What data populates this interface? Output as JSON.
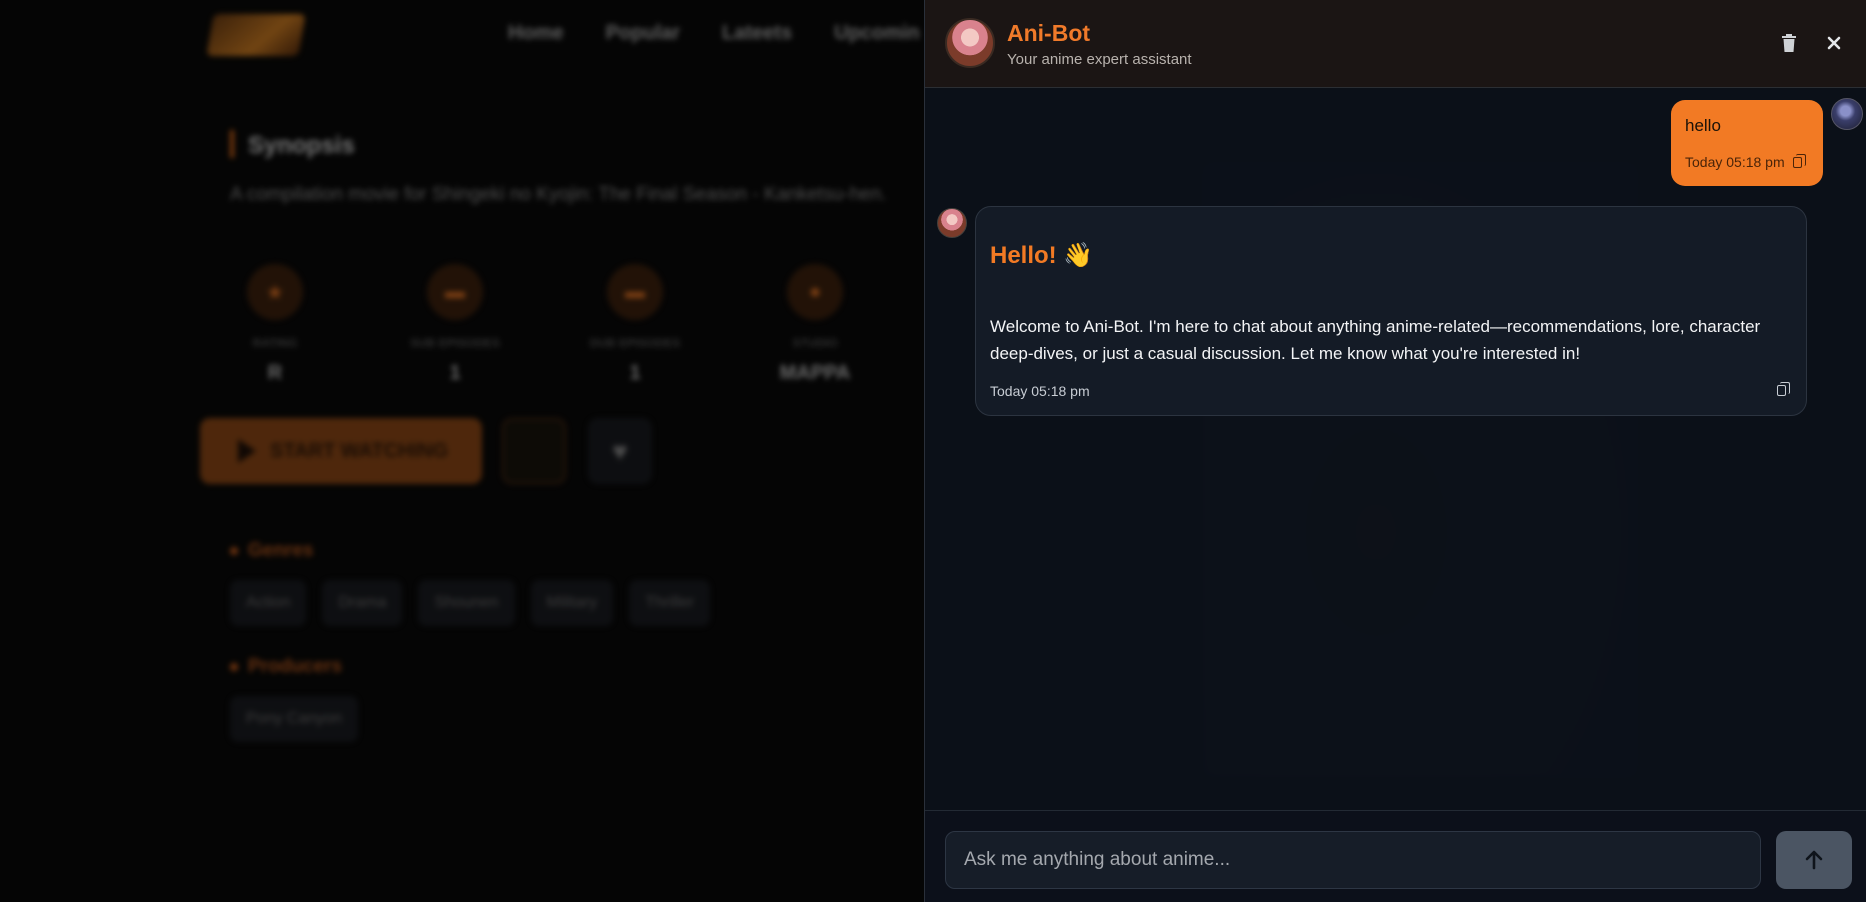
{
  "background": {
    "nav": [
      "Home",
      "Popular",
      "Lateets",
      "Upcomin"
    ],
    "synopsis_title": "Synopsis",
    "synopsis_text": "A compilation movie for Shingeki no Kyojin: The Final Season - Kanketsu-hen.",
    "stats": [
      {
        "label": "RATING",
        "value": "R",
        "icon": "star-icon"
      },
      {
        "label": "SUB EPISODES",
        "value": "1",
        "icon": "subtitle-icon"
      },
      {
        "label": "DUB EPISODES",
        "value": "1",
        "icon": "microphone-icon"
      },
      {
        "label": "STUDIO",
        "value": "MAPPA",
        "icon": "studio-icon"
      }
    ],
    "watch_label": "START WATCHING",
    "genres_title": "Genres",
    "genres": [
      "Action",
      "Drama",
      "Shounen",
      "Military",
      "Thriller"
    ],
    "producers_title": "Producers",
    "producers": [
      "Pony Canyon"
    ]
  },
  "chat": {
    "bot_name": "Ani-Bot",
    "bot_subtitle": "Your anime expert assistant",
    "user_message": "hello",
    "user_time": "Today 05:18 pm",
    "bot_hello": "Hello! 👋",
    "bot_message": "Welcome to Ani-Bot. I'm here to chat about anything anime-related—recommendations, lore, character deep-dives, or just a casual discussion. Let me know what you're interested in!",
    "bot_time": "Today 05:18 pm",
    "input_placeholder": "Ask me anything about anime...",
    "input_value": ""
  },
  "colors": {
    "accent": "#f27a24",
    "panel_bg": "#0c111a",
    "send_button": "#4b5563"
  }
}
